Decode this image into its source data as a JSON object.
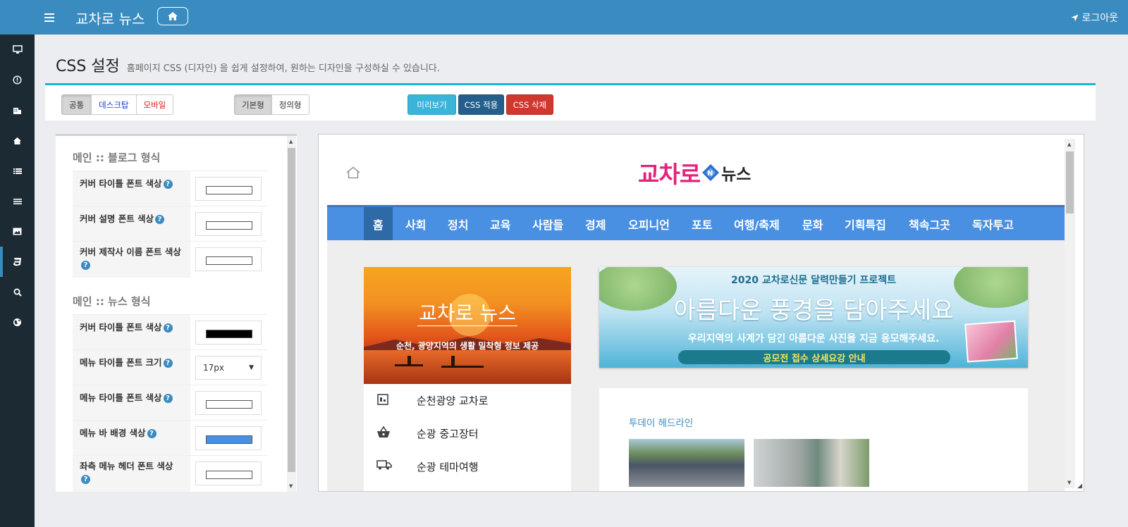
{
  "header": {
    "site_title": "교차로 뉴스",
    "logout_label": "로그아웃"
  },
  "sidebar": {
    "icons": [
      "monitor-icon",
      "info-circle-icon",
      "building-icon",
      "home-icon",
      "list-icon",
      "menu-lines-icon",
      "image-icon",
      "css3-icon",
      "search-icon",
      "globe-icon"
    ],
    "active_index": 7
  },
  "page": {
    "title": "CSS 설정",
    "description": "홈페이지 CSS (디자인) 을 쉽게 설정하여, 원하는 디자인을 구성하실 수 있습니다."
  },
  "toolbar": {
    "device_tabs": [
      {
        "label": "공통",
        "color": "#333333"
      },
      {
        "label": "데스크탑",
        "color": "#1a3fd0"
      },
      {
        "label": "모바일",
        "color": "#d0201a"
      }
    ],
    "device_active": "공통",
    "mode_tabs": [
      "기본형",
      "정의형"
    ],
    "mode_active": "기본형",
    "preview_label": "미리보기",
    "apply_label": "CSS 적용",
    "delete_label": "CSS 삭제",
    "colors": {
      "preview": "#3ab4d8",
      "apply": "#245f8c",
      "delete": "#d0372e"
    }
  },
  "settings": {
    "blog_section": {
      "title": "메인 :: 블로그 형식",
      "rows": [
        {
          "label": "커버 타이틀 폰트 색상",
          "type": "color",
          "value": "#ffffff"
        },
        {
          "label": "커버 설명 폰트 색상",
          "type": "color",
          "value": "#ffffff"
        },
        {
          "label": "커버 제작사 이름 폰트 색상",
          "type": "color",
          "value": "#ffffff"
        }
      ]
    },
    "news_section": {
      "title": "메인 :: 뉴스 형식",
      "rows": [
        {
          "label": "커버 타이틀 폰트 색상",
          "type": "color",
          "value": "#000000"
        },
        {
          "label": "메뉴 타이틀 폰트 크기",
          "type": "select",
          "value": "17px"
        },
        {
          "label": "메뉴 타이틀 폰트 색상",
          "type": "color",
          "value": "#ffffff"
        },
        {
          "label": "메뉴 바 배경 색상",
          "type": "color",
          "value": "#4a90e2"
        },
        {
          "label": "좌측 메뉴 헤더 폰트 색상",
          "type": "color",
          "value": "#ffffff"
        }
      ]
    }
  },
  "preview": {
    "logo_main": "교차로",
    "logo_sub": "뉴스",
    "menu": [
      "홈",
      "사회",
      "정치",
      "교육",
      "사람들",
      "경제",
      "오피니언",
      "포토",
      "여행/축제",
      "문화",
      "기획특집",
      "책속그곳",
      "독자투고"
    ],
    "menu_active": "홈",
    "menu_bg": "#4a90e2",
    "cover_title": "교차로 뉴스",
    "cover_desc": "순천, 광양지역의 생활 밀착형 정보 제공",
    "links": [
      {
        "icon": "building-icon",
        "label": "순천광양 교차로"
      },
      {
        "icon": "basket-icon",
        "label": "순광 중고장터"
      },
      {
        "icon": "truck-icon",
        "label": "순광 테마여행"
      }
    ],
    "banner": {
      "line1": "2020 교차로신문 달력만들기 프로젝트",
      "line2": "아름다운 풍경을 담아주세요",
      "line3": "우리지역의 사계가 담긴 아름다운 사진을 지금 응모해주세요.",
      "pill": "공모전 접수 상세요강 안내"
    },
    "headline_title": "투데이 헤드라인"
  }
}
